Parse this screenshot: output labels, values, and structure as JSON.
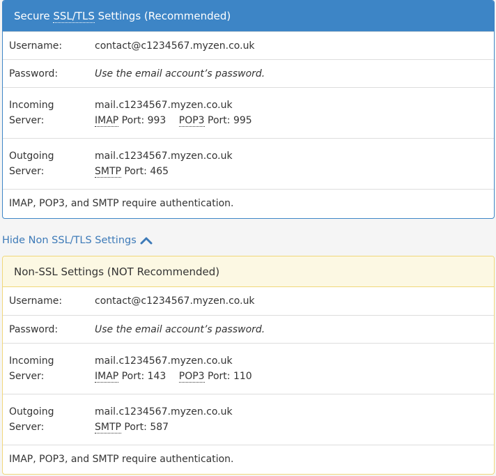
{
  "ssl": {
    "title_prefix": "Secure ",
    "title_abbr": "SSL/TLS",
    "title_suffix": " Settings (Recommended)",
    "username_label": "Username:",
    "username_value": "contact@c1234567.myzen.co.uk",
    "password_label": "Password:",
    "password_value": "Use the email account’s password.",
    "incoming_label_1": "Incoming",
    "incoming_label_2": "Server:",
    "incoming_host": "mail.c1234567.myzen.co.uk",
    "imap_abbr": "IMAP",
    "imap_port_text": " Port: 993",
    "pop3_abbr": "POP3",
    "pop3_port_text": " Port: 995",
    "outgoing_label_1": "Outgoing",
    "outgoing_label_2": "Server:",
    "outgoing_host": "mail.c1234567.myzen.co.uk",
    "smtp_abbr": "SMTP",
    "smtp_port_text": " Port: 465",
    "note": "IMAP, POP3, and SMTP require authentication."
  },
  "toggle": {
    "label": "Hide Non SSL/TLS Settings",
    "icon": "chevron-up-icon"
  },
  "nonssl": {
    "title": "Non-SSL Settings (NOT Recommended)",
    "username_label": "Username:",
    "username_value": "contact@c1234567.myzen.co.uk",
    "password_label": "Password:",
    "password_value": "Use the email account’s password.",
    "incoming_label_1": "Incoming",
    "incoming_label_2": "Server:",
    "incoming_host": "mail.c1234567.myzen.co.uk",
    "imap_abbr": "IMAP",
    "imap_port_text": " Port: 143",
    "pop3_abbr": "POP3",
    "pop3_port_text": " Port: 110",
    "outgoing_label_1": "Outgoing",
    "outgoing_label_2": "Server:",
    "outgoing_host": "mail.c1234567.myzen.co.uk",
    "smtp_abbr": "SMTP",
    "smtp_port_text": " Port: 587",
    "note": "IMAP, POP3, and SMTP require authentication."
  },
  "colors": {
    "ssl_header": "#3d85c6",
    "nonssl_header": "#fcf8e3",
    "link": "#3d7ab8"
  }
}
